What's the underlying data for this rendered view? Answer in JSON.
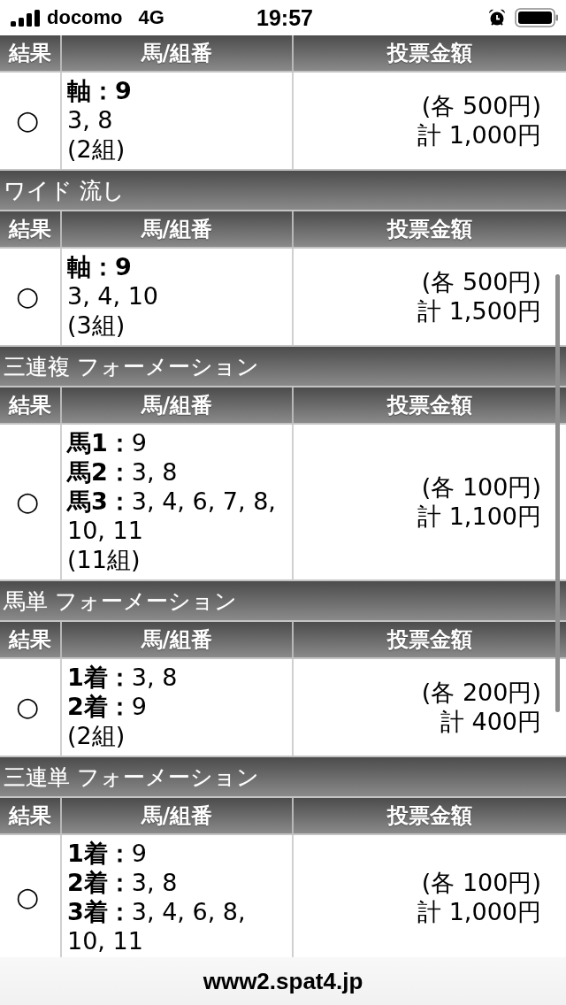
{
  "status_bar": {
    "carrier": "docomo",
    "network": "4G",
    "time": "19:57"
  },
  "sections": [
    {
      "columns": [
        "結果",
        "馬/組番",
        "投票金額"
      ],
      "rows": [
        {
          "result": "○",
          "lines": [
            {
              "kind": "strong",
              "text": "軸：9"
            },
            {
              "kind": "plain",
              "text": "3, 8"
            }
          ],
          "count": "(2組)",
          "amounts": {
            "unit": "(各 500円)",
            "total": "計 1,000円"
          }
        }
      ]
    },
    {
      "title": "ワイド 流し",
      "columns": [
        "結果",
        "馬/組番",
        "投票金額"
      ],
      "rows": [
        {
          "result": "○",
          "lines": [
            {
              "kind": "strong",
              "text": "軸：9"
            },
            {
              "kind": "plain",
              "text": "3, 4, 10"
            }
          ],
          "count": "(3組)",
          "amounts": {
            "unit": "(各 500円)",
            "total": "計 1,500円"
          }
        }
      ]
    },
    {
      "title": "三連複 フォーメーション",
      "columns": [
        "結果",
        "馬/組番",
        "投票金額"
      ],
      "rows": [
        {
          "result": "○",
          "lines": [
            {
              "kind": "plain",
              "text": "**馬1：**9"
            },
            {
              "kind": "plain",
              "text": "**馬2：**3, 8"
            },
            {
              "kind": "plain",
              "text": "**馬3：**3, 4, 6, 7, 8, 10, 11"
            }
          ],
          "count": "(11組)",
          "amounts": {
            "unit": "(各 100円)",
            "total": "計 1,100円"
          }
        }
      ]
    },
    {
      "title": "馬単 フォーメーション",
      "columns": [
        "結果",
        "馬/組番",
        "投票金額"
      ],
      "rows": [
        {
          "result": "○",
          "lines": [
            {
              "kind": "plain",
              "text": "**1着：**3, 8"
            },
            {
              "kind": "plain",
              "text": "**2着：**9"
            }
          ],
          "count": "(2組)",
          "amounts": {
            "unit": "(各 200円)",
            "total": "計 400円"
          }
        }
      ]
    },
    {
      "title": "三連単 フォーメーション",
      "columns": [
        "結果",
        "馬/組番",
        "投票金額"
      ],
      "rows": [
        {
          "result": "○",
          "lines": [
            {
              "kind": "plain",
              "text": "**1着：**9"
            },
            {
              "kind": "plain",
              "text": "**2着：**3, 8"
            },
            {
              "kind": "plain",
              "text": "**3着：**3, 4, 6, 8, 10, 11"
            }
          ],
          "amounts": {
            "unit": "(各 100円)",
            "total": "計 1,000円"
          }
        }
      ]
    }
  ],
  "address_bar": {
    "url": "www2.spat4.jp"
  }
}
